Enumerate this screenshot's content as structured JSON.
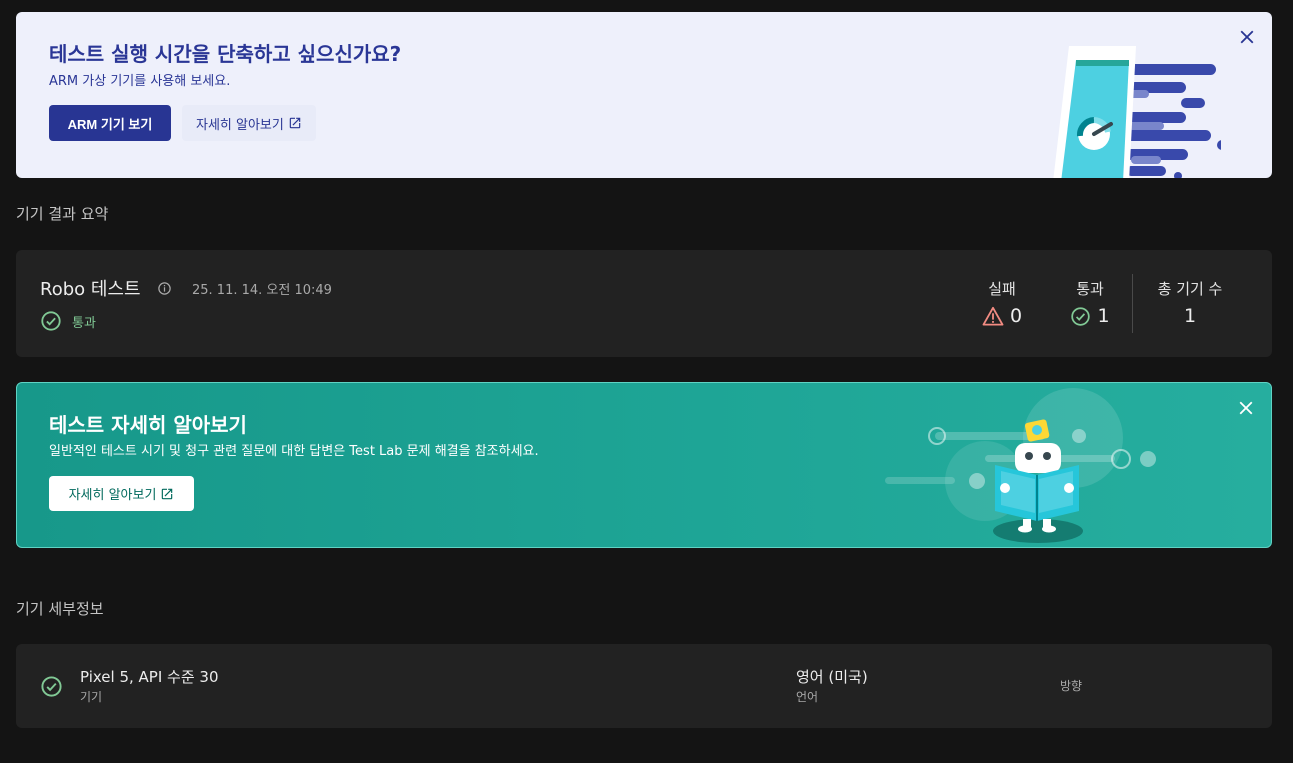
{
  "promo": {
    "title": "테스트 실행 시간을 단축하고 싶으신가요?",
    "subtitle": "ARM 가상 기기를 사용해 보세요.",
    "primary_button": "ARM 기기 보기",
    "learn_more": "자세히 알아보기",
    "close_icon": "close-icon",
    "accent_color": "#283593"
  },
  "summary": {
    "section_title": "기기 결과 요약",
    "test_name": "Robo 테스트",
    "date": "25. 11. 14. 오전 10:49",
    "status": "통과",
    "stats": [
      {
        "label": "실패",
        "value": "0",
        "icon": "warning-icon"
      },
      {
        "label": "통과",
        "value": "1",
        "icon": "check-circle-icon"
      },
      {
        "label": "총 기기 수",
        "value": "1"
      }
    ],
    "fail_color": "#f28b82",
    "pass_color": "#81c995"
  },
  "teal_banner": {
    "title": "테스트 자세히 알아보기",
    "subtitle": "일반적인 테스트 시기 및 청구 관련 질문에 대한 답변은 Test Lab 문제 해결을 참조하세요.",
    "button": "자세히 알아보기",
    "close_icon": "close-icon"
  },
  "details": {
    "section_title": "기기 세부정보",
    "device_name": "Pixel 5, API 수준 30",
    "device_label": "기기",
    "language_value": "영어 (미국)",
    "language_label": "언어",
    "orientation_label": "방향"
  }
}
